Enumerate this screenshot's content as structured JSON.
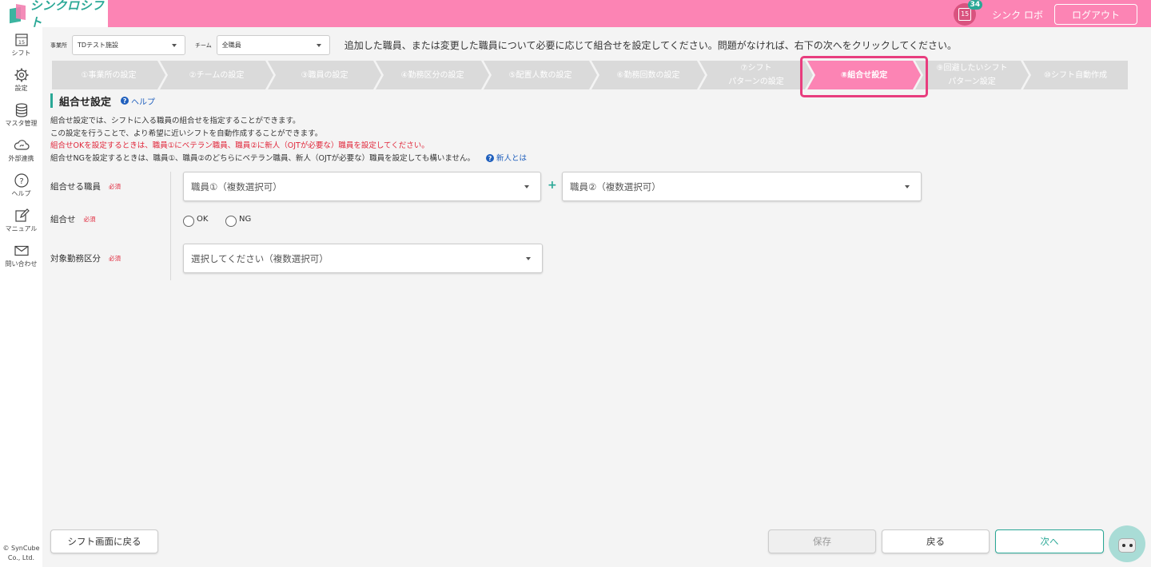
{
  "app": {
    "name": "シンクロシフト",
    "user_name": "シンク ロボ",
    "logout_label": "ログアウト",
    "calendar_day": "15",
    "notification_count": "34",
    "colors": {
      "accent_pink": "#fc84b4",
      "accent_teal": "#2aa896",
      "link_blue": "#1f5fbd",
      "warn_red": "#e0263a"
    }
  },
  "sidebar": {
    "items": [
      {
        "label": "シフト",
        "icon": "calendar-icon",
        "day": "15"
      },
      {
        "label": "設定",
        "icon": "gear-icon"
      },
      {
        "label": "マスタ管理",
        "icon": "database-icon"
      },
      {
        "label": "外部連携",
        "icon": "cloud-sync-icon"
      },
      {
        "label": "ヘルプ",
        "icon": "question-icon"
      },
      {
        "label": "マニュアル",
        "icon": "edit-icon"
      },
      {
        "label": "問い合わせ",
        "icon": "mail-icon"
      }
    ],
    "copyright_line1": "© SynCube",
    "copyright_line2": "Co., Ltd."
  },
  "filters": {
    "office_label": "事業所",
    "office_value": "TDテスト施設",
    "team_label": "チーム",
    "team_value": "全職員"
  },
  "instruction": "追加した職員、または変更した職員について必要に応じて組合せを設定してください。問題がなければ、右下の次へをクリックしてください。",
  "steps": [
    {
      "line1": "①事業所の設定",
      "line2": "",
      "active": false
    },
    {
      "line1": "②チームの設定",
      "line2": "",
      "active": false
    },
    {
      "line1": "③職員の設定",
      "line2": "",
      "active": false
    },
    {
      "line1": "④勤務区分の設定",
      "line2": "",
      "active": false
    },
    {
      "line1": "⑤配置人数の設定",
      "line2": "",
      "active": false
    },
    {
      "line1": "⑥勤務回数の設定",
      "line2": "",
      "active": false
    },
    {
      "line1": "⑦シフト",
      "line2": "パターンの設定",
      "active": false
    },
    {
      "line1": "⑧組合せ設定",
      "line2": "",
      "active": true
    },
    {
      "line1": "⑨回避したいシフト",
      "line2": "パターン設定",
      "active": false
    },
    {
      "line1": "⑩シフト自動作成",
      "line2": "",
      "active": false
    }
  ],
  "section": {
    "title": "組合せ設定",
    "help_label": "ヘルプ"
  },
  "description": {
    "line1": "組合せ設定では、シフトに入る職員の組合せを指定することができます。",
    "line2": "この設定を行うことで、より希望に近いシフトを自動作成することができます。",
    "line3": "組合せOKを設定するときは、職員①にベテラン職員、職員②に新人（OJTが必要な）職員を設定してください。",
    "line4": "組合せNGを設定するときは、職員①、職員②のどちらにベテラン職員、新人（OJTが必要な）職員を設定しても構いません。",
    "newbie_link": "新人とは"
  },
  "form": {
    "required_label": "必須",
    "staff_label": "組合せる職員",
    "staff1_placeholder": "職員①（複数選択可）",
    "staff2_placeholder": "職員②（複数選択可）",
    "plus": "+",
    "combo_label": "組合せ",
    "option_ok": "OK",
    "option_ng": "NG",
    "shift_type_label": "対象勤務区分",
    "shift_type_placeholder": "選択してください（複数選択可）"
  },
  "buttons": {
    "back_to_shift": "シフト画面に戻る",
    "save": "保存",
    "back": "戻る",
    "next": "次へ"
  }
}
